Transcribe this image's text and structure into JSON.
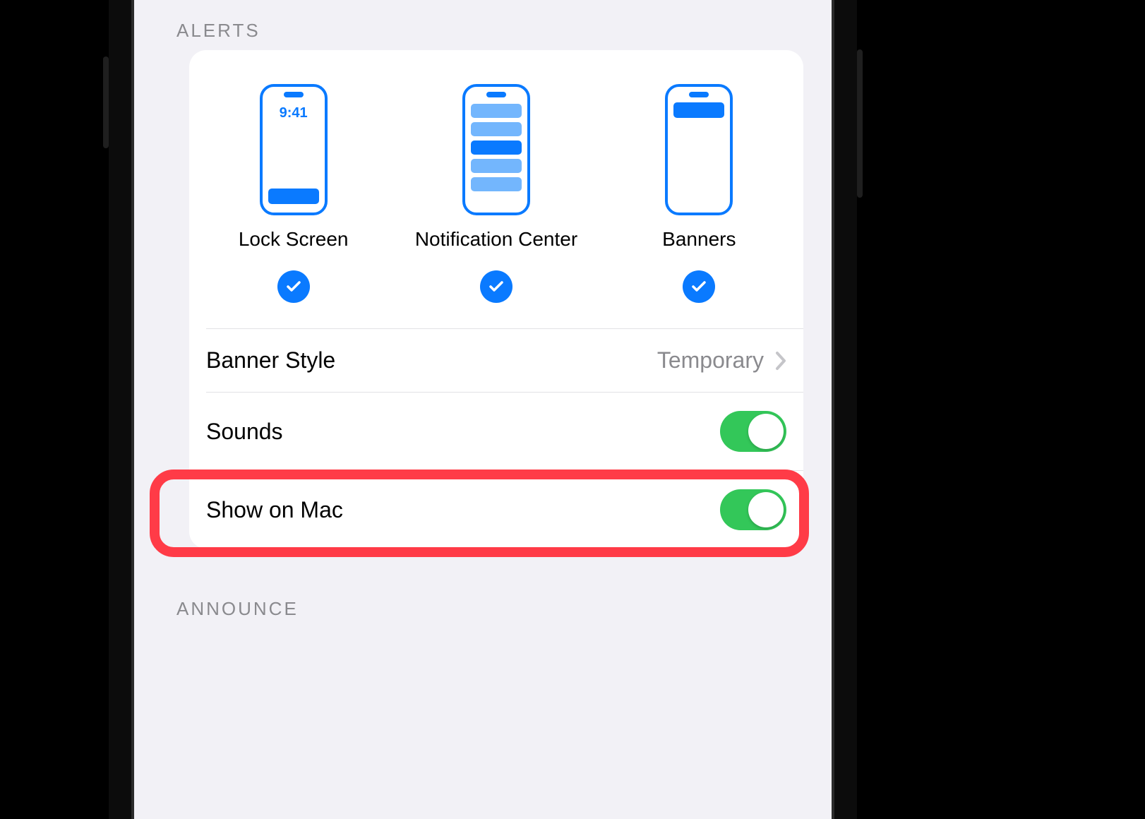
{
  "sections": {
    "alerts_header": "ALERTS",
    "announce_header": "ANNOUNCE"
  },
  "alerts": {
    "lock_screen": {
      "label": "Lock Screen",
      "time": "9:41",
      "checked": true
    },
    "notification_center": {
      "label": "Notification Center",
      "checked": true
    },
    "banners": {
      "label": "Banners",
      "checked": true
    }
  },
  "rows": {
    "banner_style": {
      "label": "Banner Style",
      "value": "Temporary"
    },
    "sounds": {
      "label": "Sounds",
      "on": true
    },
    "show_on_mac": {
      "label": "Show on Mac",
      "on": true
    }
  },
  "colors": {
    "accent": "#0A7AFF",
    "toggle_on": "#33C759",
    "highlight": "#FF3B47"
  }
}
